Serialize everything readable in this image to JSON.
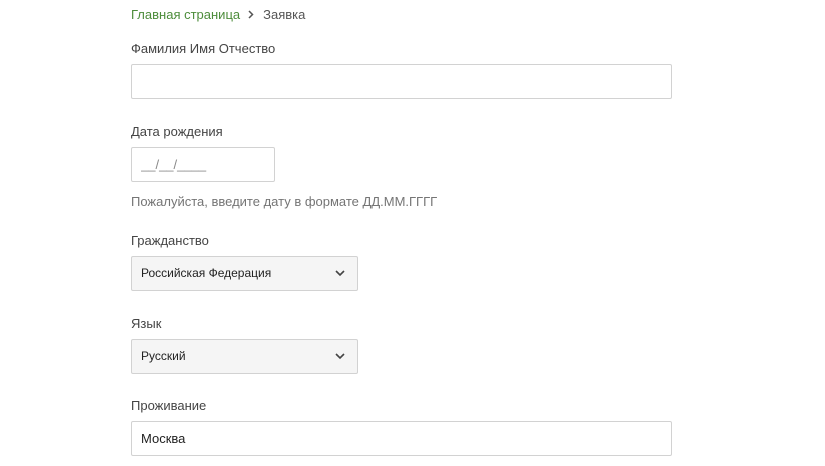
{
  "breadcrumb": {
    "home": "Главная страница",
    "current": "Заявка"
  },
  "form": {
    "full_name": {
      "label": "Фамилия Имя Отчество",
      "value": ""
    },
    "birth_date": {
      "label": "Дата рождения",
      "placeholder": "__/__/____",
      "hint": "Пожалуйста, введите дату в формате ДД.ММ.ГГГГ"
    },
    "citizenship": {
      "label": "Гражданство",
      "value": "Российская Федерация"
    },
    "language": {
      "label": "Язык",
      "value": "Русский"
    },
    "residence": {
      "label": "Проживание",
      "value": "Москва"
    }
  },
  "icons": {
    "breadcrumb_separator": "chevron-right-icon",
    "select_arrow": "chevron-down-icon"
  },
  "colors": {
    "link": "#4c8c3a",
    "border": "#d2d2d2",
    "select_bg": "#f5f5f5"
  }
}
